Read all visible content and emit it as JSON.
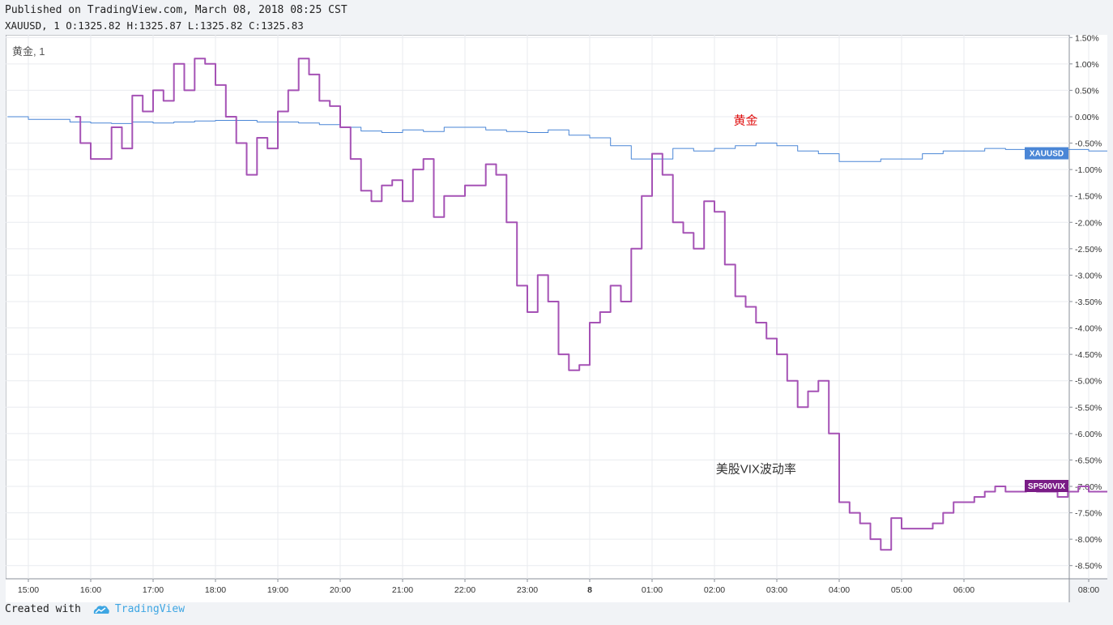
{
  "header": {
    "published": "Published on TradingView.com, March 08, 2018 08:25 CST",
    "ohlc": "XAUUSD, 1 O:1325.82 H:1325.87 L:1325.82 C:1325.83"
  },
  "footer": {
    "created_with": "Created with",
    "brand": "TradingView"
  },
  "colors": {
    "xauusd": "#4a86d6",
    "vix": "#a552b5",
    "gold_annotation": "#e01010",
    "vix_badge": "#7a1c86"
  },
  "chart_data": {
    "type": "line",
    "symbol_label": "黄金, 1",
    "annotations": [
      {
        "text": "黄金",
        "color": "#e01010",
        "x": "02:30",
        "y": -0.15
      },
      {
        "text": "美股VIX波动率",
        "color": "#333333",
        "x": "02:40",
        "y": -6.75
      }
    ],
    "y_axis": {
      "unit": "%",
      "range": [
        -8.75,
        1.55
      ],
      "ticks": [
        "1.50%",
        "1.00%",
        "0.50%",
        "0.00%",
        "-0.50%",
        "-1.00%",
        "-1.50%",
        "-2.00%",
        "-2.50%",
        "-3.00%",
        "-3.50%",
        "-4.00%",
        "-4.50%",
        "-5.00%",
        "-5.50%",
        "-6.00%",
        "-6.50%",
        "-7.00%",
        "-7.50%",
        "-8.00%",
        "-8.50%"
      ]
    },
    "x_axis": {
      "ticks": [
        "15:00",
        "16:00",
        "17:00",
        "18:00",
        "19:00",
        "20:00",
        "21:00",
        "22:00",
        "23:00",
        "8",
        "01:00",
        "02:00",
        "03:00",
        "04:00",
        "05:00",
        "06:00",
        "08:00"
      ]
    },
    "grid": true,
    "series": [
      {
        "name": "XAUUSD",
        "x": [
          "14:40",
          "15:00",
          "15:20",
          "15:40",
          "16:00",
          "16:20",
          "16:40",
          "17:00",
          "17:20",
          "17:40",
          "18:00",
          "18:20",
          "18:40",
          "19:00",
          "19:20",
          "19:40",
          "20:00",
          "20:20",
          "20:40",
          "21:00",
          "21:20",
          "21:40",
          "22:00",
          "22:20",
          "22:40",
          "23:00",
          "23:20",
          "23:40",
          "00:00",
          "00:20",
          "00:40",
          "01:00",
          "01:20",
          "01:40",
          "02:00",
          "02:20",
          "02:40",
          "03:00",
          "03:20",
          "03:40",
          "04:00",
          "04:20",
          "04:40",
          "05:00",
          "05:20",
          "05:40",
          "06:00",
          "06:20",
          "06:40",
          "07:00",
          "07:20",
          "07:40",
          "08:00",
          "08:25"
        ],
        "values": [
          0.0,
          -0.05,
          -0.05,
          -0.1,
          -0.12,
          -0.13,
          -0.1,
          -0.12,
          -0.1,
          -0.08,
          -0.07,
          -0.07,
          -0.1,
          -0.1,
          -0.12,
          -0.15,
          -0.2,
          -0.27,
          -0.3,
          -0.25,
          -0.28,
          -0.2,
          -0.2,
          -0.25,
          -0.28,
          -0.3,
          -0.25,
          -0.35,
          -0.4,
          -0.55,
          -0.8,
          -0.8,
          -0.6,
          -0.65,
          -0.6,
          -0.55,
          -0.5,
          -0.55,
          -0.65,
          -0.7,
          -0.85,
          -0.85,
          -0.8,
          -0.8,
          -0.7,
          -0.65,
          -0.65,
          -0.6,
          -0.62,
          -0.6,
          -0.6,
          -0.62,
          -0.65,
          -0.7
        ]
      },
      {
        "name": "SP500VIX",
        "x": [
          "15:45",
          "15:50",
          "16:00",
          "16:10",
          "16:20",
          "16:30",
          "16:40",
          "16:50",
          "17:00",
          "17:10",
          "17:20",
          "17:30",
          "17:40",
          "17:50",
          "18:00",
          "18:10",
          "18:20",
          "18:30",
          "18:40",
          "18:50",
          "19:00",
          "19:10",
          "19:20",
          "19:30",
          "19:40",
          "19:50",
          "20:00",
          "20:10",
          "20:20",
          "20:30",
          "20:40",
          "20:50",
          "21:00",
          "21:10",
          "21:20",
          "21:30",
          "21:40",
          "21:50",
          "22:00",
          "22:10",
          "22:20",
          "22:30",
          "22:40",
          "22:50",
          "23:00",
          "23:10",
          "23:20",
          "23:30",
          "23:40",
          "23:50",
          "00:00",
          "00:10",
          "00:20",
          "00:30",
          "00:40",
          "00:50",
          "01:00",
          "01:10",
          "01:20",
          "01:30",
          "01:40",
          "01:50",
          "02:00",
          "02:10",
          "02:20",
          "02:30",
          "02:40",
          "02:50",
          "03:00",
          "03:10",
          "03:20",
          "03:30",
          "03:40",
          "03:50",
          "04:00",
          "04:10",
          "04:20",
          "04:30",
          "04:40",
          "04:50",
          "05:00",
          "05:10",
          "05:20",
          "05:30",
          "05:40",
          "05:50",
          "06:00",
          "06:10",
          "06:20",
          "06:30",
          "06:40",
          "06:50",
          "07:00",
          "07:10",
          "07:20",
          "07:30",
          "07:40",
          "07:50",
          "08:00",
          "08:10",
          "08:20"
        ],
        "values": [
          0.0,
          -0.5,
          -0.8,
          -0.8,
          -0.2,
          -0.6,
          0.4,
          0.1,
          0.5,
          0.3,
          1.0,
          0.5,
          1.1,
          1.0,
          0.6,
          0.0,
          -0.5,
          -1.1,
          -0.4,
          -0.6,
          0.1,
          0.5,
          1.1,
          0.8,
          0.3,
          0.2,
          -0.2,
          -0.8,
          -1.4,
          -1.6,
          -1.3,
          -1.2,
          -1.6,
          -1.0,
          -0.8,
          -1.9,
          -1.5,
          -1.5,
          -1.3,
          -1.3,
          -0.9,
          -1.1,
          -2.0,
          -3.2,
          -3.7,
          -3.0,
          -3.5,
          -4.5,
          -4.8,
          -4.7,
          -3.9,
          -3.7,
          -3.2,
          -3.5,
          -2.5,
          -1.5,
          -0.7,
          -1.1,
          -2.0,
          -2.2,
          -2.5,
          -1.6,
          -1.8,
          -2.8,
          -3.4,
          -3.6,
          -3.9,
          -4.2,
          -4.5,
          -5.0,
          -5.5,
          -5.2,
          -5.0,
          -6.0,
          -7.3,
          -7.5,
          -7.7,
          -8.0,
          -8.2,
          -7.6,
          -7.8,
          -7.8,
          -7.8,
          -7.7,
          -7.5,
          -7.3,
          -7.3,
          -7.2,
          -7.1,
          -7.0,
          -7.1,
          -7.1,
          -6.9,
          -7.1,
          -7.1,
          -7.2,
          -7.1,
          -7.0,
          -7.1,
          -7.1,
          -7.0
        ]
      }
    ]
  }
}
